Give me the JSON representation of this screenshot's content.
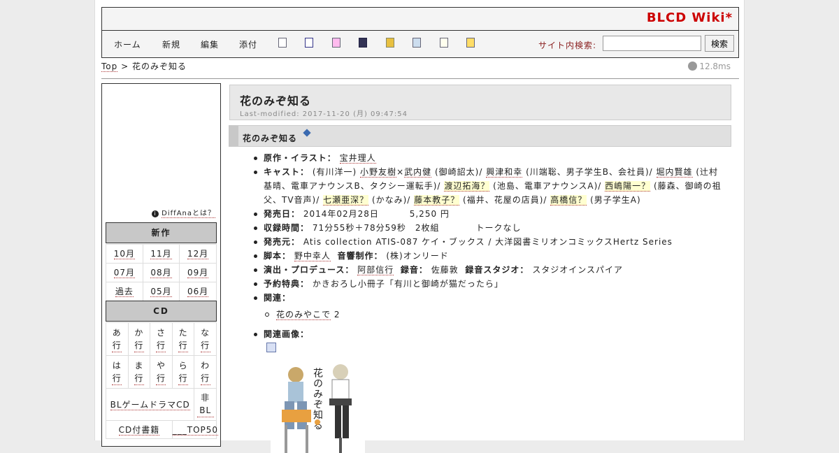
{
  "site": {
    "title": "BLCD Wiki*"
  },
  "nav": {
    "home": "ホーム",
    "new": "新規",
    "edit": "編集",
    "attach": "添付",
    "tool_icons": [
      "copy-icon",
      "diff-icon",
      "backup-icon",
      "save-icon",
      "freeze-icon",
      "rename-icon",
      "list-icon",
      "help-icon"
    ]
  },
  "search": {
    "label": "サイト内検索:",
    "button": "検索",
    "value": ""
  },
  "breadcrumb": {
    "top": "Top",
    "separator": ">",
    "current": "花のみぞ知る"
  },
  "timing": "12.8ms",
  "sidebar": {
    "diffana": "DiffAnaとは？",
    "new_heading": "新作",
    "new_items": [
      [
        "10月",
        "11月",
        "12月"
      ],
      [
        "07月",
        "08月",
        "09月"
      ],
      [
        "過去",
        "05月",
        "06月"
      ]
    ],
    "cd_heading": "CD",
    "kana_row1": [
      "あ行",
      "か行",
      "さ行",
      "た行",
      "な行"
    ],
    "kana_row2": [
      "は行",
      "ま行",
      "や行",
      "ら行",
      "わ行"
    ],
    "extra_row1": [
      "BLゲームドラマCD",
      "非BL"
    ],
    "extra_row2": [
      "CD付書籍",
      "___TOP50"
    ]
  },
  "main": {
    "title": "花のみぞ知る",
    "last_modified": "Last-modified: 2017-11-20 (月) 09:47:54",
    "section_title": "花のみぞ知る",
    "info": {
      "original_label": "原作・イラスト：",
      "original": "宝井理人",
      "cast_label": "キャスト：",
      "cast_1": "(有川洋一)",
      "cast_1_va": "小野友樹",
      "cast_x": "×",
      "cast_2_va": "武内健",
      "cast_2": "(御崎詔太)/",
      "cast_3_va": "興津和幸",
      "cast_3": "(川端聡、男子学生B、会社員)/",
      "cast_4_va": "堀内賢雄",
      "cast_4": "(辻村基晴、電車アナウンスB、タクシー運転手)/",
      "cast_5_va": "渡辺拓海？",
      "cast_5": "(池島、電車アナウンスA)/",
      "cast_6_va": "西嶋陽一？",
      "cast_6": "(藤森、御崎の祖父、TV音声)/",
      "cast_7_va": "七瀬亜深？",
      "cast_7": "(かなみ)/",
      "cast_8_va": "藤本教子？",
      "cast_8": "(福井、花屋の店員)/",
      "cast_9_va": "高橋信？",
      "cast_9": "(男子学生A)",
      "release_label": "発売日：",
      "release": "2014年02月28日　　　 5,250 円",
      "runtime_label": "収録時間：",
      "runtime": "71分55秒＋78分59秒　2枚組　　　　トークなし",
      "publisher_label": "発売元：",
      "publisher": "Atis collection ATIS-087 ケイ・ブックス / 大洋図書ミリオンコミックスHertz Series",
      "script_label": "脚本：",
      "script": "野中幸人",
      "sound_label": "音響制作：",
      "sound": "(株)オンリード",
      "director_label": "演出・プロデュース：",
      "director": "阿部信行",
      "recording_label": "録音：",
      "recording": "佐藤敦",
      "studio_label": "録音スタジオ：",
      "studio": "スタジオインスパイア",
      "bonus_label": "予約特典：",
      "bonus": "かきおろし小冊子「有川と御崎が猫だったら」",
      "related_label": "関連：",
      "related_link": "花のみやこで",
      "related_suffix": "2",
      "image_label": "関連画像："
    },
    "cover_text": "花のみぞ知る"
  }
}
